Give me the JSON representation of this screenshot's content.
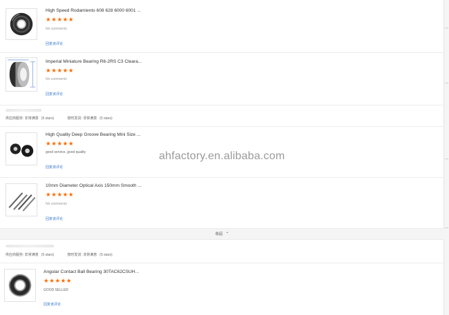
{
  "reviews": [
    {
      "title": "High Speed Rodamiento 608 628 6000 6001 ...",
      "stars": "★★★★★",
      "comment": "No comments",
      "reply_link": "回复该评论",
      "image": "bearing-icon"
    },
    {
      "title": "Imperial Miniature Bearing R6-2RS C3 Cleara...",
      "stars": "★★★★★",
      "comment": "No comments",
      "reply_link": "回复该评论",
      "image": "bearing-drawing-icon"
    },
    {
      "title": "High Quality Deep Groove Bearing Mini Size ...",
      "stars": "★★★★★",
      "comment": "good service, good quality",
      "reply_link": "回复该评论",
      "image": "small-bearings-icon"
    },
    {
      "title": "10mm Diameter Optical Axis 150mm Smooth ...",
      "stars": "★★★★★",
      "comment": "No comments",
      "reply_link": "回复该评论",
      "image": "shafts-icon"
    },
    {
      "title": "Angular Contact Ball Bearing 30TAC62CSUH...",
      "stars": "★★★★★",
      "comment": "GOOD SELLER",
      "reply_link": "回复该评论",
      "image": "bearing-icon"
    }
  ],
  "supplier_ratings": [
    {
      "supplier_service": "供应商服务: 非常满意",
      "supplier_stars": "(5 stars)",
      "delivery": "按时发货: 非常满意",
      "delivery_stars": "(5 stars)"
    },
    {
      "supplier_service": "供应商服务: 非常满意",
      "supplier_stars": "(5 stars)",
      "delivery": "按时发货: 非常满意",
      "delivery_stars": "(5 stars)"
    }
  ],
  "collapse": {
    "label": "收起",
    "icon": "chevron-up-icon"
  },
  "watermark": "ahfactory.en.alibaba.com",
  "colors": {
    "star": "#ff6a00",
    "link": "#3a7bd5"
  }
}
